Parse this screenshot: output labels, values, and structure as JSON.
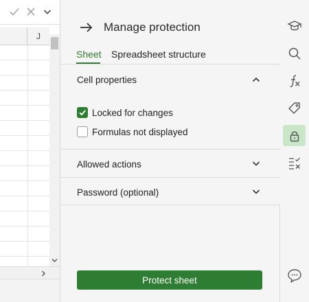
{
  "formula_bar": {
    "confirm_icon": "check-icon",
    "cancel_icon": "close-icon",
    "expand_icon": "chevron-down-icon"
  },
  "sheet": {
    "visible_column": "J"
  },
  "panel": {
    "title": "Manage protection",
    "tabs": [
      {
        "label": "Sheet",
        "active": true
      },
      {
        "label": "Spreadsheet structure",
        "active": false
      }
    ],
    "sections": {
      "cell_properties": {
        "title": "Cell properties",
        "expanded": true,
        "options": [
          {
            "label": "Locked for changes",
            "checked": true
          },
          {
            "label": "Formulas not displayed",
            "checked": false
          }
        ]
      },
      "allowed_actions": {
        "title": "Allowed actions",
        "expanded": false
      },
      "password": {
        "title": "Password (optional)",
        "expanded": false
      }
    },
    "protect_button": "Protect sheet"
  },
  "rail": {
    "items": [
      {
        "icon": "graduation-cap-icon",
        "active": false
      },
      {
        "icon": "search-icon",
        "active": false
      },
      {
        "icon": "function-icon",
        "active": false
      },
      {
        "icon": "tag-icon",
        "active": false
      },
      {
        "icon": "lock-icon",
        "active": true
      },
      {
        "icon": "checklist-icon",
        "active": false
      },
      {
        "icon": "chat-icon",
        "active": false
      }
    ]
  },
  "colors": {
    "accent": "#2e7d32",
    "active_rail_bg": "#c9e6c9",
    "panel_bg": "#f5f5f5"
  }
}
